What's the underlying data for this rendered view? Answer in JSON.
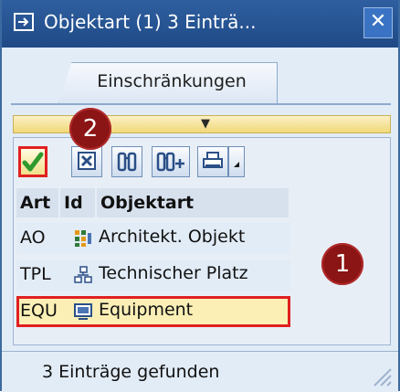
{
  "window": {
    "title": "Objektart (1)   3 Einträ...",
    "close_symbol": "✕"
  },
  "tabs": [
    {
      "label": "Einschränkungen",
      "active": true
    }
  ],
  "collapse_arrow": "▼",
  "toolbar": {
    "buttons": [
      {
        "name": "confirm",
        "icon": "checkmark-icon"
      },
      {
        "name": "cancel",
        "icon": "cancel-icon"
      },
      {
        "name": "find",
        "icon": "binoculars-icon"
      },
      {
        "name": "find-next",
        "icon": "binoculars-plus-icon"
      },
      {
        "name": "print",
        "icon": "printer-icon"
      },
      {
        "name": "print-options",
        "icon": "dropdown-icon"
      }
    ]
  },
  "annotations": {
    "one": "1",
    "two": "2"
  },
  "table": {
    "columns": [
      "Art",
      "Id",
      "Objektart"
    ],
    "rows": [
      {
        "art": "AO",
        "icon": "architectural-object-icon",
        "objektart": "Architekt. Objekt"
      },
      {
        "art": "TPL",
        "icon": "functional-location-icon",
        "objektart": "Technischer Platz"
      },
      {
        "art": "EQU",
        "icon": "equipment-icon",
        "objektart": "Equipment",
        "selected": true
      }
    ]
  },
  "status": {
    "text": "3 Einträge gefunden"
  },
  "colors": {
    "title_bar": "#2f5fa0",
    "highlight_border": "#e02020",
    "annotation": "#8b1414",
    "selected_row": "#fbefb6"
  }
}
